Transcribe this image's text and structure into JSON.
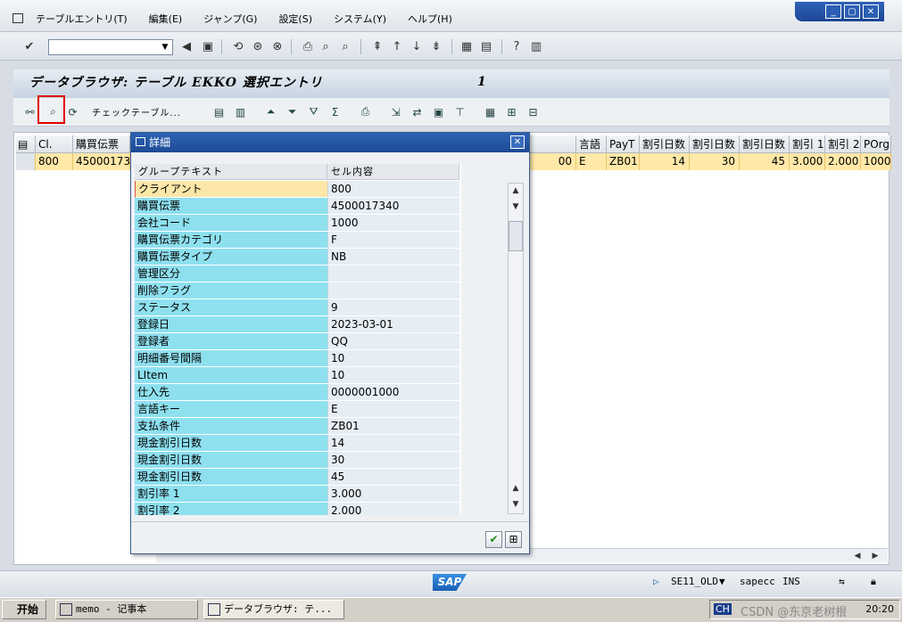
{
  "menubar": {
    "items": [
      "テーブルエントリ(T)",
      "編集(E)",
      "ジャンプ(G)",
      "設定(S)",
      "システム(Y)",
      "ヘルプ(H)"
    ]
  },
  "window": {
    "min": "_",
    "max": "▢",
    "close": "✕"
  },
  "page": {
    "title": "データブラウザ: テーブル EKKO 選択エントリ",
    "count": "1"
  },
  "apptoolbar": {
    "check_table": "チェックテーブル..."
  },
  "grid": {
    "headers": [
      "Cl.",
      "購買伝票",
      "",
      "言語",
      "PayT",
      "割引日数",
      "割引日数",
      "割引日数",
      "割引 1",
      "割引 2",
      "POrg"
    ],
    "row": [
      "800",
      "4500017340",
      "00",
      "E",
      "ZB01",
      "14",
      "30",
      "45",
      "3.000",
      "2.000",
      "1000"
    ]
  },
  "dialog": {
    "title": "詳細",
    "col_group": "グループテキスト",
    "col_cell": "セル内容",
    "rows": [
      {
        "label": "クライアント",
        "value": "800"
      },
      {
        "label": "購買伝票",
        "value": "4500017340"
      },
      {
        "label": "会社コード",
        "value": "1000"
      },
      {
        "label": "購買伝票カテゴリ",
        "value": "F"
      },
      {
        "label": "購買伝票タイプ",
        "value": "NB"
      },
      {
        "label": "管理区分",
        "value": ""
      },
      {
        "label": "削除フラグ",
        "value": ""
      },
      {
        "label": "ステータス",
        "value": "9"
      },
      {
        "label": "登録日",
        "value": "2023-03-01"
      },
      {
        "label": "登録者",
        "value": "QQ"
      },
      {
        "label": "明細番号間隔",
        "value": "10"
      },
      {
        "label": "LItem",
        "value": "10"
      },
      {
        "label": "仕入先",
        "value": "0000001000"
      },
      {
        "label": "言語キー",
        "value": "E"
      },
      {
        "label": "支払条件",
        "value": "ZB01"
      },
      {
        "label": "現金割引日数",
        "value": "14"
      },
      {
        "label": "現金割引日数",
        "value": "30"
      },
      {
        "label": "現金割引日数",
        "value": "45"
      },
      {
        "label": "割引率 1",
        "value": "3.000"
      },
      {
        "label": "割引率 2",
        "value": "2.000"
      }
    ]
  },
  "status": {
    "tcode": "SE11_OLD",
    "system": "sapecc",
    "mode": "INS",
    "logo": "SAP"
  },
  "taskbar": {
    "start": "开始",
    "task1": "memo - 记事本",
    "task2": "データブラウザ: テ...",
    "lang": "CH",
    "clock": "20:20",
    "watermark": "CSDN @东京老树根"
  }
}
